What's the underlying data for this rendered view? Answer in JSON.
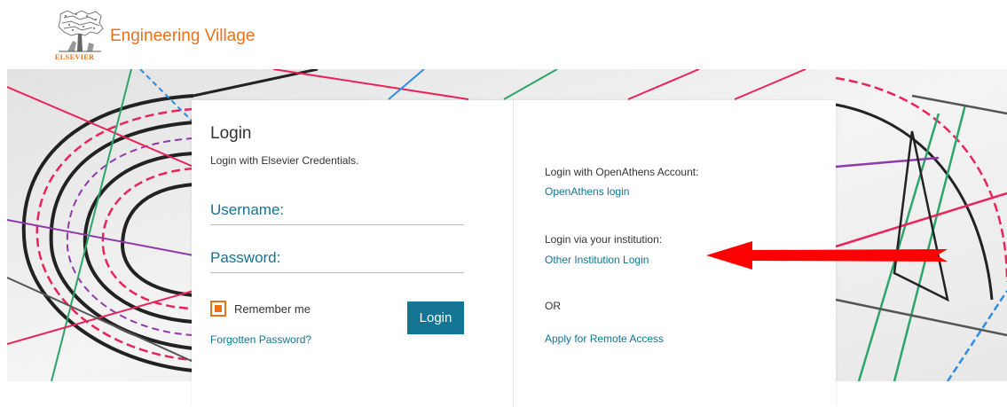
{
  "header": {
    "logo_word": "ELSEVIER",
    "brand": "Engineering Village"
  },
  "login": {
    "title": "Login",
    "subtitle": "Login with Elsevier Credentials.",
    "username_label": "Username:",
    "password_label": "Password:",
    "remember_label": "Remember me",
    "remember_checked": true,
    "login_button": "Login",
    "forgot_link": "Forgotten Password?"
  },
  "alternatives": {
    "openathens_text": "Login with OpenAthens Account:",
    "openathens_link": "OpenAthens login",
    "institution_text": "Login via your institution:",
    "institution_link": "Other Institution Login",
    "or_text": "OR",
    "remote_link": "Apply for Remote Access"
  },
  "colors": {
    "brand_orange": "#e9711c",
    "link_blue": "#137494",
    "button_blue": "#137494",
    "annotation_arrow": "#ff0000"
  },
  "icons": {
    "logo": "elsevier-tree-logo",
    "arrow": "red-arrow-pointing-left"
  }
}
